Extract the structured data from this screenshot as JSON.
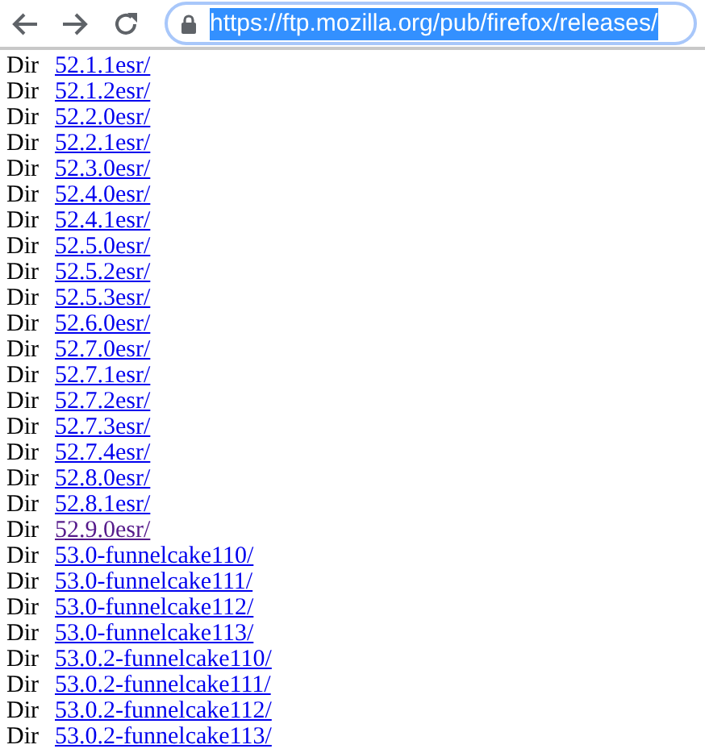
{
  "toolbar": {
    "url": "https://ftp.mozilla.org/pub/firefox/releases/",
    "url_selected": true
  },
  "rows": [
    {
      "type": "Dir",
      "name": "52.1.1esr/",
      "visited": false
    },
    {
      "type": "Dir",
      "name": "52.1.2esr/",
      "visited": false
    },
    {
      "type": "Dir",
      "name": "52.2.0esr/",
      "visited": false
    },
    {
      "type": "Dir",
      "name": "52.2.1esr/",
      "visited": false
    },
    {
      "type": "Dir",
      "name": "52.3.0esr/",
      "visited": false
    },
    {
      "type": "Dir",
      "name": "52.4.0esr/",
      "visited": false
    },
    {
      "type": "Dir",
      "name": "52.4.1esr/",
      "visited": false
    },
    {
      "type": "Dir",
      "name": "52.5.0esr/",
      "visited": false
    },
    {
      "type": "Dir",
      "name": "52.5.2esr/",
      "visited": false
    },
    {
      "type": "Dir",
      "name": "52.5.3esr/",
      "visited": false
    },
    {
      "type": "Dir",
      "name": "52.6.0esr/",
      "visited": false
    },
    {
      "type": "Dir",
      "name": "52.7.0esr/",
      "visited": false
    },
    {
      "type": "Dir",
      "name": "52.7.1esr/",
      "visited": false
    },
    {
      "type": "Dir",
      "name": "52.7.2esr/",
      "visited": false
    },
    {
      "type": "Dir",
      "name": "52.7.3esr/",
      "visited": false
    },
    {
      "type": "Dir",
      "name": "52.7.4esr/",
      "visited": false
    },
    {
      "type": "Dir",
      "name": "52.8.0esr/",
      "visited": false
    },
    {
      "type": "Dir",
      "name": "52.8.1esr/",
      "visited": false
    },
    {
      "type": "Dir",
      "name": "52.9.0esr/",
      "visited": true
    },
    {
      "type": "Dir",
      "name": "53.0-funnelcake110/",
      "visited": false
    },
    {
      "type": "Dir",
      "name": "53.0-funnelcake111/",
      "visited": false
    },
    {
      "type": "Dir",
      "name": "53.0-funnelcake112/",
      "visited": false
    },
    {
      "type": "Dir",
      "name": "53.0-funnelcake113/",
      "visited": false
    },
    {
      "type": "Dir",
      "name": "53.0.2-funnelcake110/",
      "visited": false
    },
    {
      "type": "Dir",
      "name": "53.0.2-funnelcake111/",
      "visited": false
    },
    {
      "type": "Dir",
      "name": "53.0.2-funnelcake112/",
      "visited": false
    },
    {
      "type": "Dir",
      "name": "53.0.2-funnelcake113/",
      "visited": false
    }
  ]
}
